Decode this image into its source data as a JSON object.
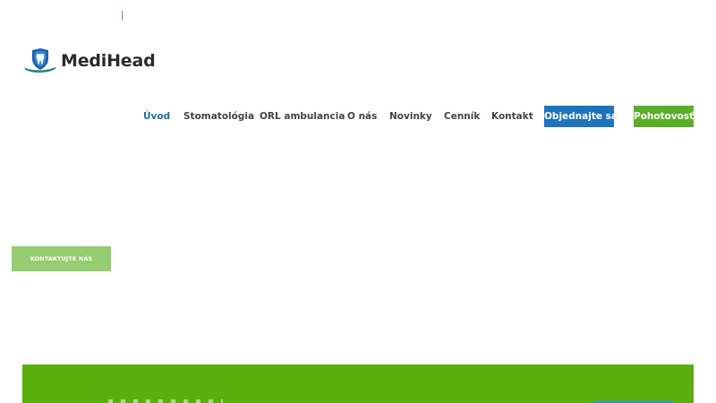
{
  "brand": {
    "name": "MediHead",
    "logo_icon": "tooth-shield-icon",
    "colors": {
      "primary_blue": "#1f73bd",
      "brand_green": "#5aaf27",
      "band_green": "#5aaf0f",
      "cta_light_green": "#95cc70",
      "text_dark": "#444444"
    }
  },
  "nav": {
    "items": [
      {
        "label": "Úvod",
        "active": true
      },
      {
        "label": "Stomatológia",
        "active": false
      },
      {
        "label": "ORL ambulancia",
        "active": false
      },
      {
        "label": "O nás",
        "active": false
      },
      {
        "label": "Novinky",
        "active": false
      },
      {
        "label": "Cenník",
        "active": false
      },
      {
        "label": "Kontakt",
        "active": false
      }
    ],
    "buttons": {
      "book": "Objednajte sa",
      "emergency": "Pohotovosť"
    }
  },
  "hero": {
    "cta_label": "KONTAKTUJTE NÁS"
  }
}
